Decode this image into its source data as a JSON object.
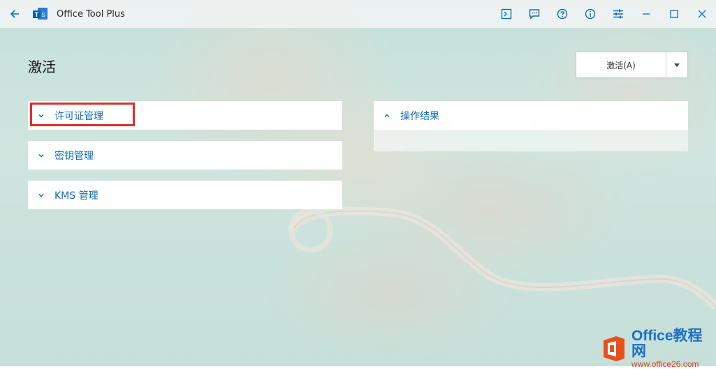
{
  "window": {
    "title": "Office Tool Plus",
    "accent_color": "#0e6fb8"
  },
  "titlebar_icons": [
    "back-arrow-icon",
    "terminal-icon",
    "feedback-icon",
    "help-icon",
    "info-icon",
    "settings-sliders-icon",
    "minimize-icon",
    "maximize-icon",
    "close-icon"
  ],
  "page": {
    "title": "激活"
  },
  "activate_button": {
    "label": "激活(A)"
  },
  "sections": [
    {
      "label": "许可证管理",
      "expanded": false,
      "highlighted": true
    },
    {
      "label": "密钥管理",
      "expanded": false
    },
    {
      "label": "KMS 管理",
      "expanded": false
    }
  ],
  "result_panel": {
    "label": "操作结果",
    "expanded": true
  },
  "watermark": {
    "line1": "Office教程网",
    "line2": "www.office26.com",
    "highlight_color": "#e32b2b"
  }
}
